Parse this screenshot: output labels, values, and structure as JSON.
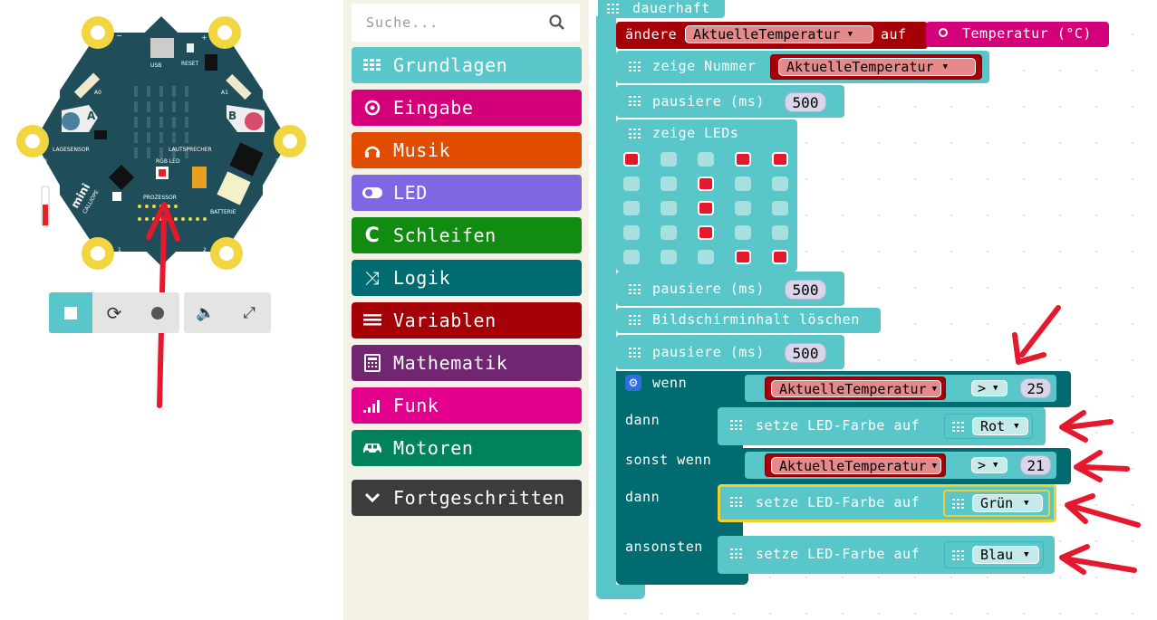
{
  "simulator": {
    "board_labels": {
      "usb": "USB",
      "reset": "RESET",
      "a0": "A0",
      "a1": "A1",
      "btn_a": "A",
      "btn_b": "B",
      "lagesensor": "LAGESENSOR",
      "lautsprecher": "LAUTSPRECHER",
      "rgb_led": "RGB LED",
      "prozessor": "PROZESSOR",
      "batterie": "BATTERIE",
      "brand": "CALLIOPE",
      "brand2": "mini",
      "minus": "−",
      "plus": "+",
      "pin0": "0",
      "pin1": "1",
      "pin2": "2",
      "pin3": "3"
    },
    "buttons": [
      "stop-icon",
      "restart-icon",
      "slowmo-icon",
      "mute-icon",
      "fullscreen-icon"
    ],
    "accent": "#59c7c9"
  },
  "toolbox": {
    "search_placeholder": "Suche...",
    "categories": [
      {
        "label": "Grundlagen",
        "color": "#59c7c9",
        "icon": "grid-icon"
      },
      {
        "label": "Eingabe",
        "color": "#d4007a",
        "icon": "target-icon"
      },
      {
        "label": "Musik",
        "color": "#e04c00",
        "icon": "headphones-icon"
      },
      {
        "label": "LED",
        "color": "#8066e3",
        "icon": "toggle-icon"
      },
      {
        "label": "Schleifen",
        "color": "#118b10",
        "icon": "refresh-icon"
      },
      {
        "label": "Logik",
        "color": "#006b70",
        "icon": "shuffle-icon"
      },
      {
        "label": "Variablen",
        "color": "#a50008",
        "icon": "list-icon"
      },
      {
        "label": "Mathematik",
        "color": "#712672",
        "icon": "calculator-icon"
      },
      {
        "label": "Funk",
        "color": "#e3008c",
        "icon": "signal-icon"
      },
      {
        "label": "Motoren",
        "color": "#00825c",
        "icon": "car-icon"
      },
      {
        "label": "Fortgeschritten",
        "color": "#3c3c3c",
        "icon": "chevron-down-icon"
      }
    ]
  },
  "blocks": {
    "forever": "dauerhaft",
    "set_var": {
      "prefix": "ändere",
      "var": "AktuelleTemperatur",
      "mid": "auf",
      "value": "Temperatur (°C)"
    },
    "show_number": {
      "label": "zeige Nummer",
      "var": "AktuelleTemperatur"
    },
    "pause1": {
      "label": "pausiere (ms)",
      "value": "500"
    },
    "show_leds": {
      "label": "zeige LEDs",
      "grid": [
        [
          1,
          0,
          0,
          1,
          1
        ],
        [
          0,
          0,
          1,
          0,
          0
        ],
        [
          0,
          0,
          1,
          0,
          0
        ],
        [
          0,
          0,
          1,
          0,
          0
        ],
        [
          0,
          0,
          0,
          1,
          1
        ]
      ]
    },
    "pause2": {
      "label": "pausiere (ms)",
      "value": "500"
    },
    "clear": "Bildschirminhalt löschen",
    "pause3": {
      "label": "pausiere (ms)",
      "value": "500"
    },
    "if_block": {
      "wenn": "wenn",
      "dann": "dann",
      "sonst_wenn": "sonst wenn",
      "dann2": "dann",
      "ansonsten": "ansonsten",
      "cond1": {
        "var": "AktuelleTemperatur",
        "op": ">",
        "value": "25"
      },
      "cond2": {
        "var": "AktuelleTemperatur",
        "op": ">",
        "value": "21"
      },
      "set_color_label": "setze LED-Farbe auf",
      "color1": "Rot",
      "color2": "Grün",
      "color3": "Blau"
    },
    "colors": {
      "basic": "#59c7c9",
      "logic": "#006b70",
      "var": "#a50008",
      "input": "#d4007a"
    }
  }
}
